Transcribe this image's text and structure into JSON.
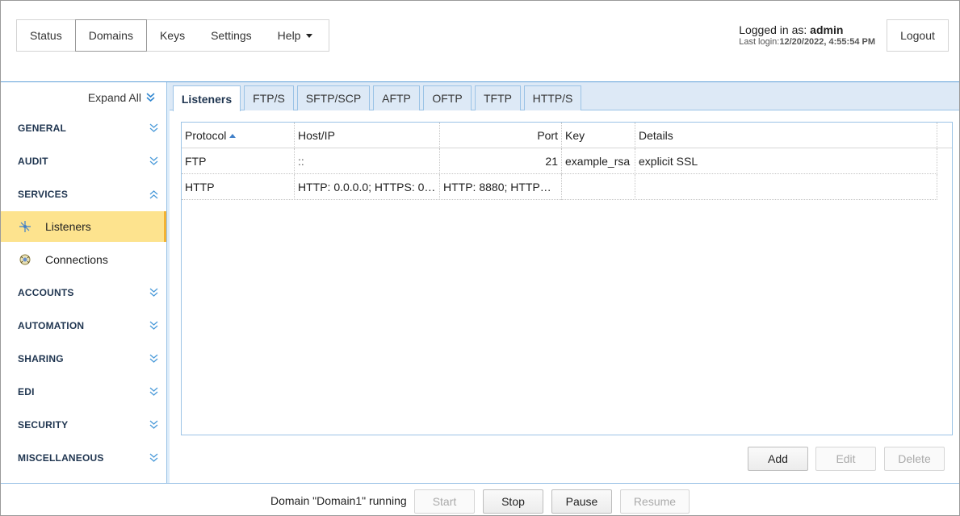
{
  "topnav": {
    "items": [
      {
        "label": "Status"
      },
      {
        "label": "Domains"
      },
      {
        "label": "Keys"
      },
      {
        "label": "Settings"
      },
      {
        "label": "Help"
      }
    ]
  },
  "login": {
    "prefix": "Logged in as: ",
    "user": "admin",
    "last_login_label": "Last login:",
    "last_login_value": "12/20/2022, 4:55:54 PM"
  },
  "logout_label": "Logout",
  "sidebar": {
    "expand_all": "Expand All",
    "sections": [
      {
        "label": "GENERAL"
      },
      {
        "label": "AUDIT"
      },
      {
        "label": "SERVICES"
      },
      {
        "label": "ACCOUNTS"
      },
      {
        "label": "AUTOMATION"
      },
      {
        "label": "SHARING"
      },
      {
        "label": "EDI"
      },
      {
        "label": "SECURITY"
      },
      {
        "label": "MISCELLANEOUS"
      }
    ],
    "services_items": [
      {
        "label": "Listeners",
        "icon": "listeners-icon"
      },
      {
        "label": "Connections",
        "icon": "connections-icon"
      }
    ]
  },
  "tabs": [
    {
      "label": "Listeners"
    },
    {
      "label": "FTP/S"
    },
    {
      "label": "SFTP/SCP"
    },
    {
      "label": "AFTP"
    },
    {
      "label": "OFTP"
    },
    {
      "label": "TFTP"
    },
    {
      "label": "HTTP/S"
    }
  ],
  "grid": {
    "columns": [
      "Protocol",
      "Host/IP",
      "Port",
      "Key",
      "Details"
    ],
    "rows": [
      {
        "protocol": "FTP",
        "host": "::",
        "port": "21",
        "key": "example_rsa",
        "details": "explicit SSL"
      },
      {
        "protocol": "HTTP",
        "host": "HTTP: 0.0.0.0; HTTPS: 0…",
        "port": "HTTP: 8880; HTTP…",
        "key": "",
        "details": ""
      }
    ]
  },
  "actions": {
    "add": "Add",
    "edit": "Edit",
    "delete": "Delete"
  },
  "footer": {
    "status": "Domain \"Domain1\" running",
    "start": "Start",
    "stop": "Stop",
    "pause": "Pause",
    "resume": "Resume"
  },
  "colors": {
    "accent": "#5fa0d8",
    "selected": "#fde38e",
    "section_text": "#1f3550"
  }
}
